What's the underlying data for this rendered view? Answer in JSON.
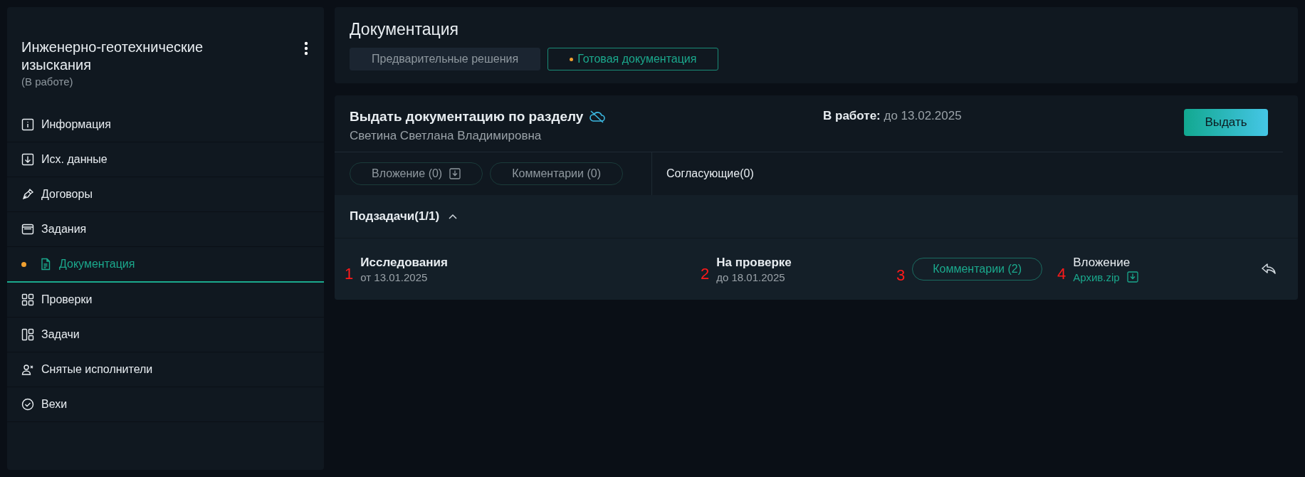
{
  "sidebar": {
    "title": "Инженерно-геотехнические изыскания",
    "status": "(В работе)",
    "items": [
      {
        "label": "Информация",
        "kind": "info",
        "selected": false
      },
      {
        "label": "Исх. данные",
        "kind": "download",
        "selected": false
      },
      {
        "label": "Договоры",
        "kind": "pen",
        "selected": false
      },
      {
        "label": "Задания",
        "kind": "window",
        "selected": false
      },
      {
        "label": "Документация",
        "kind": "document",
        "selected": true
      },
      {
        "label": "Проверки",
        "kind": "grid",
        "selected": false
      },
      {
        "label": "Задачи",
        "kind": "board",
        "selected": false
      },
      {
        "label": "Снятые исполнители",
        "kind": "userx",
        "selected": false
      },
      {
        "label": "Вехи",
        "kind": "check",
        "selected": false
      }
    ]
  },
  "page": {
    "title": "Документация",
    "tabs": [
      {
        "label": "Предварительные решения",
        "selected": false
      },
      {
        "label": "Готовая документация",
        "selected": true
      }
    ]
  },
  "task": {
    "title": "Выдать документацию по разделу",
    "assignee": "Светина Светлана Владимировна",
    "status_label": "В работе:",
    "due": "до 13.02.2025",
    "button": "Выдать",
    "attachments": "Вложение (0)",
    "comments": "Комментарии (0)",
    "approvers": "Согласующие(0)",
    "subtasks": {
      "title": "Подзадачи(1/1)",
      "expanded": true,
      "rows": [
        {
          "name": "Исследования",
          "date": "от 13.01.2025",
          "status": "На проверке",
          "due": "до 18.01.2025",
          "comments": "Комментарии (2)",
          "attachment_label": "Вложение",
          "file": "Архив.zip",
          "markers": [
            "1",
            "2",
            "3",
            "4"
          ]
        }
      ]
    }
  }
}
